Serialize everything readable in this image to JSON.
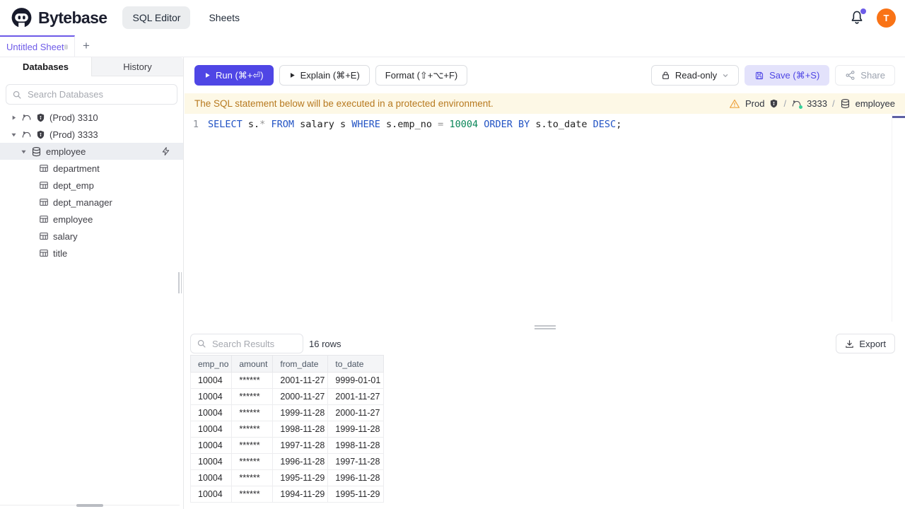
{
  "colors": {
    "accent": "#4f46e5",
    "save_button_bg": "#e3e2fb",
    "banner_bg": "#fdf8e6",
    "banner_text": "#b7791f",
    "avatar_bg": "#f97316",
    "notification_dot": "#6d5ce8",
    "active_tab_text": "#6d5ae8",
    "sql_keyword": "#2253c4",
    "sql_number": "#098658",
    "connection_ok_dot": "#34d399"
  },
  "header": {
    "brand": "Bytebase",
    "nav": [
      {
        "label": "SQL Editor",
        "active": true
      },
      {
        "label": "Sheets",
        "active": false
      }
    ],
    "avatar_initial": "T"
  },
  "tabs": {
    "sheet_title": "Untitled Sheet",
    "new_tab_glyph": "+"
  },
  "sidebar": {
    "tab_databases": "Databases",
    "tab_history": "History",
    "search_placeholder": "Search Databases",
    "instances": [
      {
        "label": "(Prod) 3310",
        "expanded": false
      },
      {
        "label": "(Prod) 3333",
        "expanded": true
      }
    ],
    "database": "employee",
    "tables": [
      "department",
      "dept_emp",
      "dept_manager",
      "employee",
      "salary",
      "title"
    ]
  },
  "toolbar": {
    "run": "Run (⌘+⏎)",
    "explain": "Explain (⌘+E)",
    "format": "Format (⇧+⌥+F)",
    "readonly": "Read-only",
    "save": "Save (⌘+S)",
    "share": "Share"
  },
  "banner": {
    "message": "The SQL statement below will be executed in a protected environment.",
    "environment": "Prod",
    "instance": "3333",
    "database": "employee",
    "sep": "/"
  },
  "editor": {
    "line_number": "1",
    "sql_text": "SELECT s.* FROM salary s WHERE s.emp_no = 10004 ORDER BY s.to_date DESC;",
    "tokens": [
      {
        "type": "keyword",
        "text": "SELECT"
      },
      {
        "type": "plain",
        "text": " s."
      },
      {
        "type": "operator",
        "text": "*"
      },
      {
        "type": "plain",
        "text": " "
      },
      {
        "type": "keyword",
        "text": "FROM"
      },
      {
        "type": "plain",
        "text": " salary s "
      },
      {
        "type": "keyword",
        "text": "WHERE"
      },
      {
        "type": "plain",
        "text": " s.emp_no "
      },
      {
        "type": "operator",
        "text": "="
      },
      {
        "type": "plain",
        "text": " "
      },
      {
        "type": "number",
        "text": "10004"
      },
      {
        "type": "plain",
        "text": " "
      },
      {
        "type": "keyword",
        "text": "ORDER BY"
      },
      {
        "type": "plain",
        "text": " s.to_date "
      },
      {
        "type": "keyword",
        "text": "DESC"
      },
      {
        "type": "plain",
        "text": ";"
      }
    ]
  },
  "results": {
    "search_placeholder": "Search Results",
    "row_count": "16 rows",
    "export_label": "Export",
    "columns": [
      "emp_no",
      "amount",
      "from_date",
      "to_date"
    ],
    "rows": [
      [
        "10004",
        "******",
        "2001-11-27",
        "9999-01-01"
      ],
      [
        "10004",
        "******",
        "2000-11-27",
        "2001-11-27"
      ],
      [
        "10004",
        "******",
        "1999-11-28",
        "2000-11-27"
      ],
      [
        "10004",
        "******",
        "1998-11-28",
        "1999-11-28"
      ],
      [
        "10004",
        "******",
        "1997-11-28",
        "1998-11-28"
      ],
      [
        "10004",
        "******",
        "1996-11-28",
        "1997-11-28"
      ],
      [
        "10004",
        "******",
        "1995-11-29",
        "1996-11-28"
      ],
      [
        "10004",
        "******",
        "1994-11-29",
        "1995-11-29"
      ]
    ]
  }
}
